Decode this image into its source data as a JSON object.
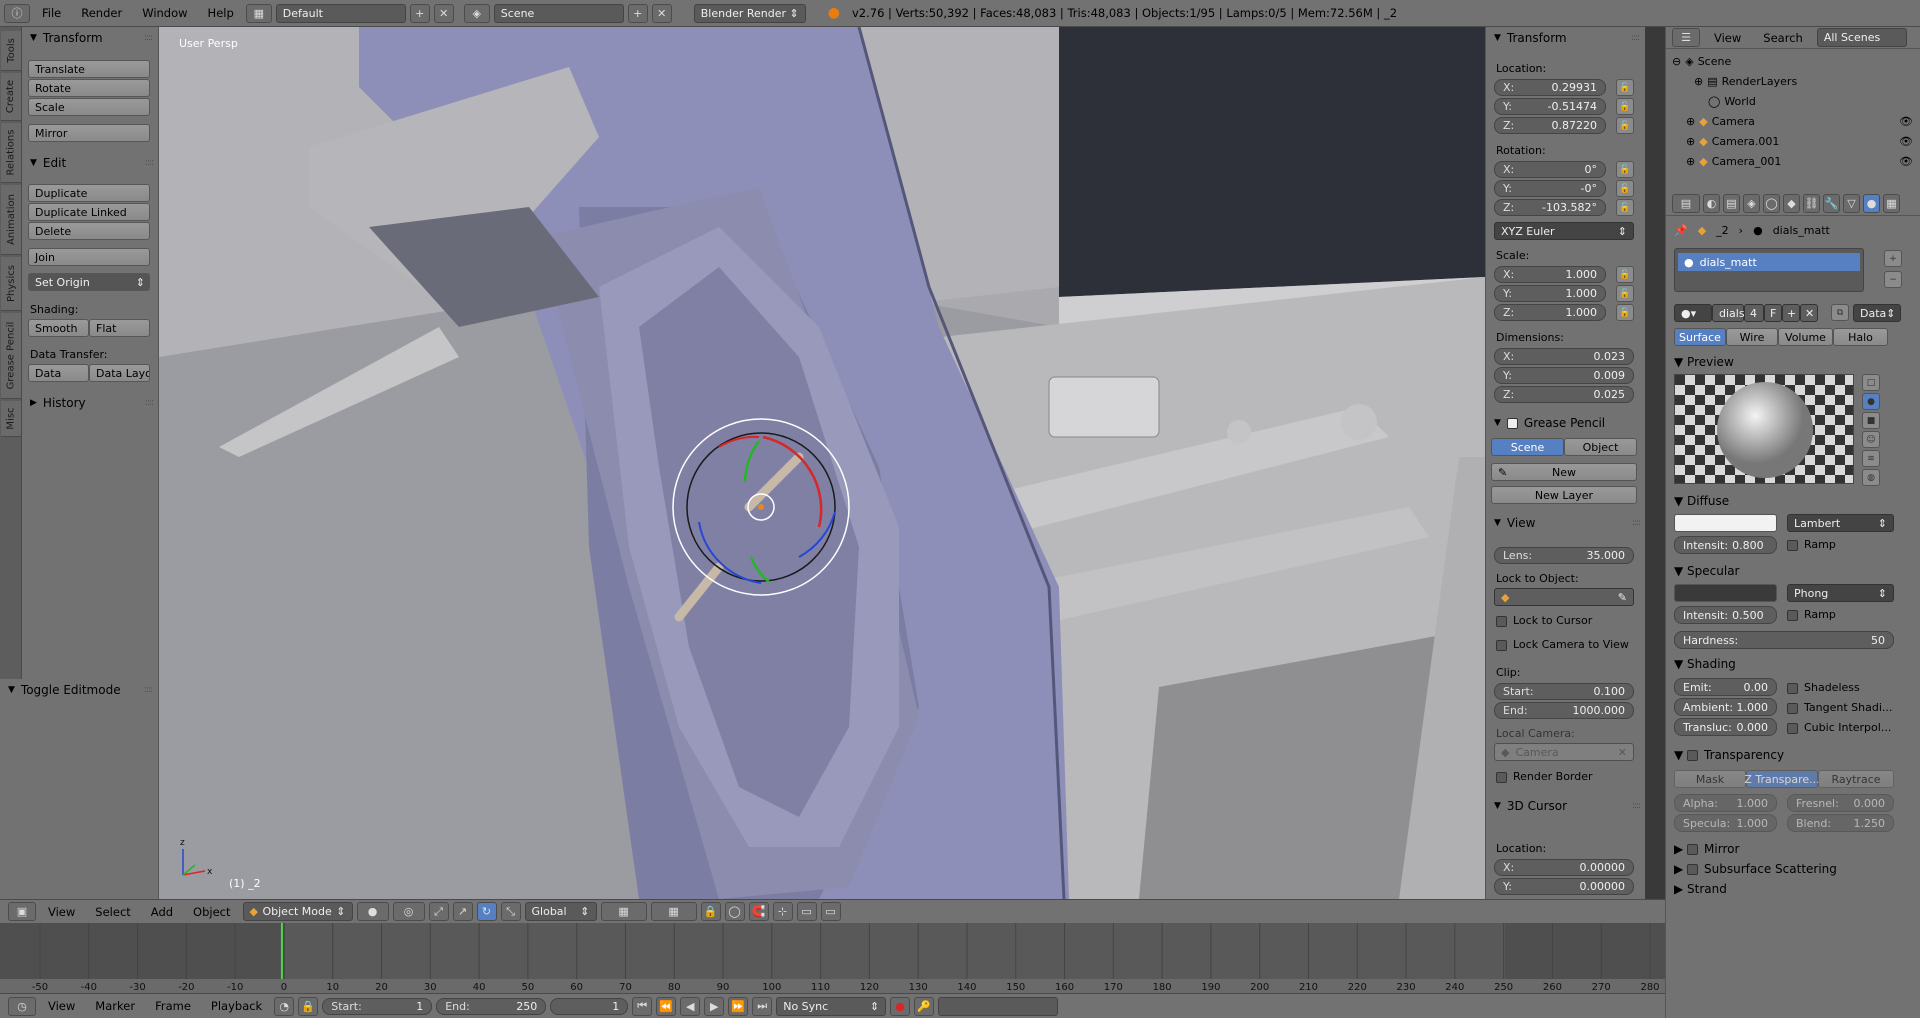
{
  "topbar": {
    "file": "File",
    "render": "Render",
    "window": "Window",
    "help": "Help",
    "layout": "Default",
    "scene": "Scene",
    "engine": "Blender Render",
    "stats": "v2.76 | Verts:50,392 | Faces:48,083 | Tris:48,083 | Objects:1/95 | Lamps:0/5 | Mem:72.56M | _2"
  },
  "tool_tabs": [
    "Tools",
    "Create",
    "Relations",
    "Animation",
    "Physics",
    "Grease Pencil",
    "Misc"
  ],
  "tools": {
    "transform_title": "Transform",
    "translate": "Translate",
    "rotate": "Rotate",
    "scale": "Scale",
    "mirror": "Mirror",
    "edit_title": "Edit",
    "duplicate": "Duplicate",
    "duplicate_linked": "Duplicate Linked",
    "delete": "Delete",
    "join": "Join",
    "set_origin": "Set Origin",
    "shading_label": "Shading:",
    "smooth": "Smooth",
    "flat": "Flat",
    "data_transfer_label": "Data Transfer:",
    "data": "Data",
    "data_layo": "Data Layo",
    "history_title": "History",
    "toggle_editmode": "Toggle Editmode"
  },
  "viewport": {
    "label": "User Persp",
    "object_label": "(1) _2"
  },
  "npanel": {
    "transform_title": "Transform",
    "location_label": "Location:",
    "loc_x": "0.29931",
    "loc_y": "-0.51474",
    "loc_z": "0.87220",
    "rotation_label": "Rotation:",
    "rot_x": "0°",
    "rot_y": "-0°",
    "rot_z": "-103.582°",
    "rot_mode": "XYZ Euler",
    "scale_label": "Scale:",
    "scale_x": "1.000",
    "scale_y": "1.000",
    "scale_z": "1.000",
    "dimensions_label": "Dimensions:",
    "dim_x": "0.023",
    "dim_y": "0.009",
    "dim_z": "0.025",
    "grease_title": "Grease Pencil",
    "gp_scene": "Scene",
    "gp_object": "Object",
    "gp_new": "New",
    "gp_new_layer": "New Layer",
    "view_title": "View",
    "lens_label": "Lens:",
    "lens_value": "35.000",
    "lock_to_object_label": "Lock to Object:",
    "lock_to_cursor": "Lock to Cursor",
    "lock_camera_to_view": "Lock Camera to View",
    "clip_label": "Clip:",
    "clip_start_label": "Start:",
    "clip_start": "0.100",
    "clip_end_label": "End:",
    "clip_end": "1000.000",
    "local_camera_label": "Local Camera:",
    "local_camera_value": "Camera",
    "render_border": "Render Border",
    "cursor_title": "3D Cursor",
    "cursor_location_label": "Location:",
    "cursor_x": "0.00000",
    "cursor_y": "0.00000"
  },
  "vp_header": {
    "view": "View",
    "select": "Select",
    "add": "Add",
    "object": "Object",
    "mode": "Object Mode",
    "orientation": "Global"
  },
  "timeline": {
    "ticks": [
      "-50",
      "-40",
      "-30",
      "-20",
      "-10",
      "0",
      "10",
      "20",
      "30",
      "40",
      "50",
      "60",
      "70",
      "80",
      "90",
      "100",
      "110",
      "120",
      "130",
      "140",
      "150",
      "160",
      "170",
      "180",
      "190",
      "200",
      "210",
      "220",
      "230",
      "240",
      "250",
      "260",
      "270",
      "280"
    ],
    "current_frame_value": 0
  },
  "tl_header": {
    "view": "View",
    "marker": "Marker",
    "frame": "Frame",
    "playback": "Playback",
    "start_label": "Start:",
    "start_value": "1",
    "end_label": "End:",
    "end_value": "250",
    "current": "1",
    "sync": "No Sync"
  },
  "outliner": {
    "view": "View",
    "search": "Search",
    "all_scenes": "All Scenes",
    "items": [
      "Scene",
      "RenderLayers",
      "World",
      "Camera",
      "Camera.001",
      "Camera_001"
    ]
  },
  "props": {
    "breadcrumb_object": "_2",
    "breadcrumb_material": "dials_matt",
    "slot_name": "dials_matt",
    "mat_name": "dials",
    "users": "4",
    "fake": "F",
    "data_mode": "Data",
    "tab_surface": "Surface",
    "tab_wire": "Wire",
    "tab_volume": "Volume",
    "tab_halo": "Halo",
    "preview_title": "Preview",
    "diffuse_title": "Diffuse",
    "diffuse_shader": "Lambert",
    "diffuse_intensity_label": "Intensit:",
    "diffuse_intensity": "0.800",
    "ramp": "Ramp",
    "specular_title": "Specular",
    "specular_shader": "Phong",
    "spec_intensity_label": "Intensit:",
    "spec_intensity": "0.500",
    "hardness_label": "Hardness:",
    "hardness": "50",
    "shading_title": "Shading",
    "emit_label": "Emit:",
    "emit": "0.00",
    "ambient_label": "Ambient:",
    "ambient": "1.000",
    "transluc_label": "Transluc:",
    "transluc": "0.000",
    "shadeless": "Shadeless",
    "tangent": "Tangent Shadi...",
    "cubic": "Cubic Interpol...",
    "transparency_title": "Transparency",
    "mask": "Mask",
    "ztransp": "Z Transpare...",
    "raytrace": "Raytrace",
    "alpha_label": "Alpha:",
    "alpha": "1.000",
    "fresnel_label": "Fresnel:",
    "fresnel": "0.000",
    "specula_label": "Specula:",
    "specula": "1.000",
    "blend_label": "Blend:",
    "blend": "1.250",
    "mirror_title": "Mirror",
    "sss_title": "Subsurface Scattering",
    "strand_title": "Strand"
  },
  "colors": {
    "gizmo_x": "#d92626",
    "gizmo_y": "#26b526",
    "gizmo_z": "#2646d9",
    "frame_line": "#4cd64c",
    "active_blue": "#5680c2"
  }
}
